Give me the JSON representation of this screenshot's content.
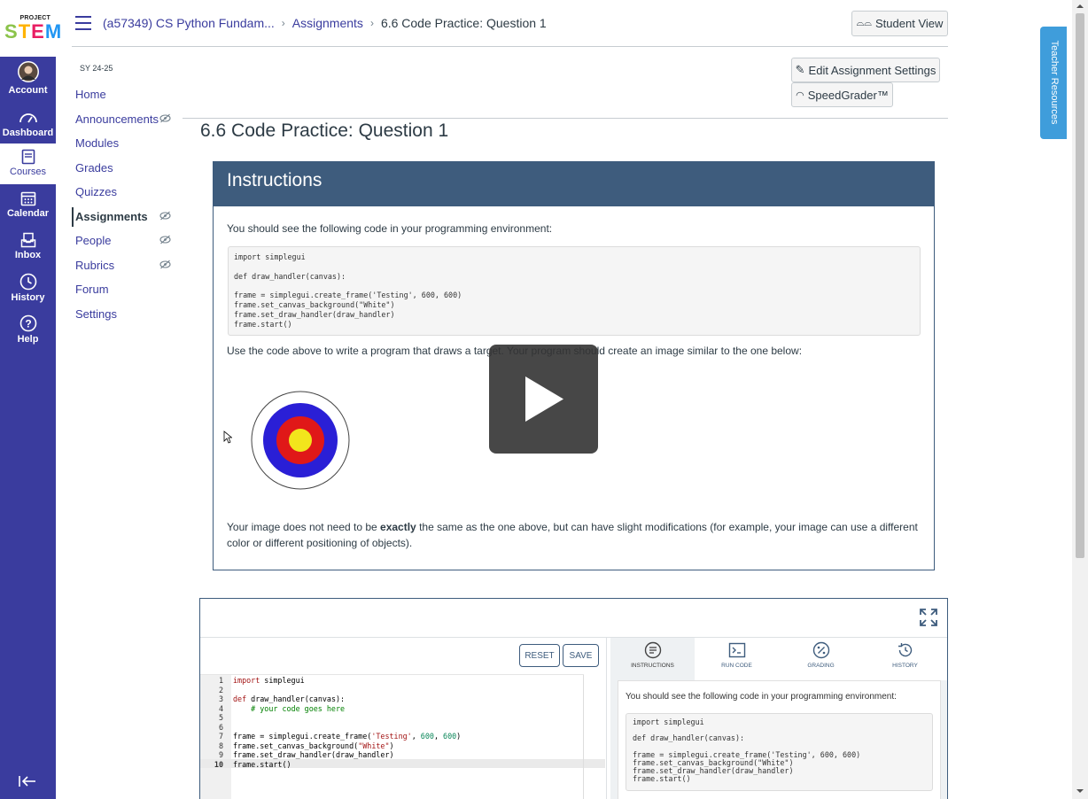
{
  "logo": {
    "top": "PROJECT",
    "main": "STEM"
  },
  "global_nav": [
    {
      "label": "Account",
      "icon": "avatar"
    },
    {
      "label": "Dashboard",
      "icon": "dashboard-icon"
    },
    {
      "label": "Courses",
      "icon": "courses-icon"
    },
    {
      "label": "Calendar",
      "icon": "calendar-icon"
    },
    {
      "label": "Inbox",
      "icon": "inbox-icon"
    },
    {
      "label": "History",
      "icon": "history-icon"
    },
    {
      "label": "Help",
      "icon": "help-icon"
    }
  ],
  "breadcrumb": {
    "course": "(a57349) CS Python Fundam...",
    "section": "Assignments",
    "current": "6.6 Code Practice: Question 1"
  },
  "header": {
    "student_view": "Student View"
  },
  "course_nav": {
    "term": "SY 24-25",
    "items": [
      "Home",
      "Announcements",
      "Modules",
      "Grades",
      "Quizzes",
      "Assignments",
      "People",
      "Rubrics",
      "Forum",
      "Settings"
    ]
  },
  "actions": {
    "edit_settings": "Edit Assignment Settings",
    "speedgrader": "SpeedGrader™"
  },
  "page_title": "6.6 Code Practice: Question 1",
  "instructions": {
    "heading": "Instructions",
    "intro": "You should see the following code in your programming environment:",
    "code": "import simplegui\n\ndef draw_handler(canvas):\n\nframe = simplegui.create_frame('Testing', 600, 600)\nframe.set_canvas_background(\"White\")\nframe.set_draw_handler(draw_handler)\nframe.start()",
    "task": "Use the code above to write a program that draws a target. Your program should create an image similar to the one below:",
    "note_before": "Your image does not need to be ",
    "note_bold": "exactly",
    "note_after": " the same as the one above, but can have slight modifications (for example, your image can use a different color or different positioning of objects)."
  },
  "target_colors": [
    "#ffffff",
    "#2a1fd6",
    "#e01818",
    "#f2e51c"
  ],
  "ide": {
    "reset": "RESET",
    "save": "SAVE",
    "line_numbers": [
      "1",
      "2",
      "3",
      "4",
      "5",
      "6",
      "7",
      "8",
      "9",
      "10"
    ],
    "tabs": [
      "INSTRUCTIONS",
      "RUN CODE",
      "GRADING",
      "HISTORY"
    ],
    "panel_intro": "You should see the following code in your programming environment:",
    "panel_code": "import simplegui\n\ndef draw_handler(canvas):\n\nframe = simplegui.create_frame('Testing', 600, 600)\nframe.set_canvas_background(\"White\")\nframe.set_draw_handler(draw_handler)\nframe.start()"
  },
  "teacher_resources": "Teacher Resources"
}
